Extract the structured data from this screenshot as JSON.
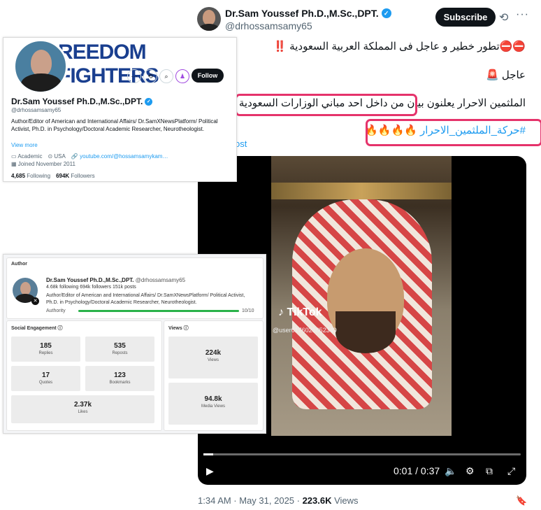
{
  "tweet": {
    "author_name": "Dr.Sam Youssef Ph.D.,M.Sc.,DPT.",
    "author_handle": "@drhossamsamy65",
    "subscribe_label": "Subscribe",
    "line1": "⛔⛔تطور خطير و عاجل فى المملكة العربية السعودية ‼️",
    "line2": "عاجل 🚨",
    "line3": "الملثمين الاحرار يعلنون بيان من داخل احد مباني الوزارات السعودية 🔥🔥",
    "line4": "#حركة_الملثمين_الاحرار 🔥🔥🔥🔥",
    "post_fragment": "ost",
    "video": {
      "watermark_app": "TikTok",
      "watermark_user": "@user6176025852349",
      "time": "0:01 / 0:37",
      "progress_fraction": 0.03
    },
    "timestamp": "1:34 AM · May 31, 2025 · ",
    "views_count": "223.6K",
    "views_label": " Views"
  },
  "profile_card": {
    "banner_text": "REEDOM FIGHTERS",
    "follow_label": "Follow",
    "name": "Dr.Sam Youssef Ph.D.,M.Sc.,DPT.",
    "handle": "@drhossamsamy65",
    "bio": "Author/Editor of American and International Affairs/ Dr.SamXNewsPlatform/ Political Activist, Ph.D. in Psychology/Doctoral Academic Researcher, Neurotheologist.",
    "view_more": "View more",
    "category": "Academic",
    "location": "USA",
    "website": "youtube.com/@hossamsamykam…",
    "joined": "Joined November 2011",
    "following_count": "4,685",
    "following_label": "Following",
    "followers_count": "694K",
    "followers_label": "Followers"
  },
  "author_card": {
    "section_title": "Author",
    "name": "Dr.Sam Youssef Ph.D.,M.Sc.,DPT.",
    "handle": "@drhossamsamy65",
    "stats": "4.68k following  694k followers  151k posts",
    "bio": "Author/Editor of American and International Affairs/ Dr.SamXNewsPlatform/ Political Activist, Ph.D. in Psychology/Doctoral Academic Researcher, Neurotheologist.",
    "authority_label": "Authority",
    "authority_value": "10/10",
    "authority_fraction": 1.0,
    "engagement_title": "Social Engagement",
    "replies": {
      "value": "185",
      "label": "Replies"
    },
    "reposts": {
      "value": "535",
      "label": "Reposts"
    },
    "quotes": {
      "value": "17",
      "label": "Quotes"
    },
    "bookmarks": {
      "value": "123",
      "label": "Bookmarks"
    },
    "likes": {
      "value": "2.37k",
      "label": "Likes"
    },
    "views_title": "Views",
    "views": {
      "value": "224k",
      "label": "Views"
    },
    "media_views": {
      "value": "94.8k",
      "label": "Media Views"
    }
  },
  "colors": {
    "accent": "#1d9bf0",
    "highlight": "#e5336b",
    "authority_bar": "#2ab24a"
  },
  "icons": [
    "verified-icon",
    "grok-icon",
    "more-icon",
    "play-icon",
    "volume-icon",
    "settings-icon",
    "pip-icon",
    "fullscreen-icon",
    "bookmark-icon",
    "x-logo-icon"
  ]
}
